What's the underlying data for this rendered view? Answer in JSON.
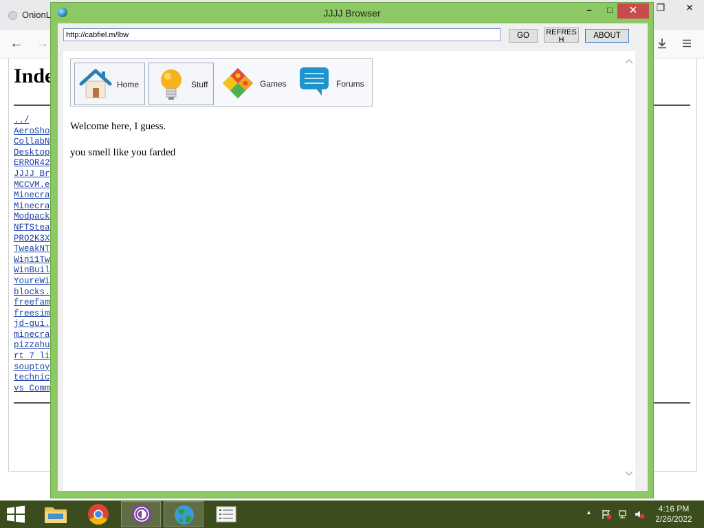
{
  "background_browser": {
    "tab_title": "OnionLi",
    "window_controls": [
      "❐",
      "✕"
    ],
    "page_heading": "Inde",
    "file_links": [
      "../",
      "AeroSho",
      "CollabN",
      "Desktop",
      "ERROR42",
      "JJJJ Br",
      "MCCVM.e",
      "Minecra",
      "Minecra",
      "Modpack",
      "NFTStea",
      "PRO2K3X",
      "TweakNT",
      "Win11Tw",
      "WinBuil",
      "YoureWi",
      "blocks.",
      "freefam",
      "freesim",
      "jd-gui.",
      "minecra",
      "pizzahu",
      "rt 7 li",
      "souptoy",
      "technic",
      "vs Comm"
    ]
  },
  "app": {
    "title": "JJJJ Browser",
    "url_value": "http://cabfiel.m/lbw",
    "go_label": "GO",
    "refresh_label": "REFRES H",
    "about_label": "ABOUT",
    "nav": [
      {
        "label": "Home",
        "icon": "home-icon"
      },
      {
        "label": "Stuff",
        "icon": "lightbulb-icon"
      },
      {
        "label": "Games",
        "icon": "puzzle-icon"
      },
      {
        "label": "Forums",
        "icon": "speech-bubble-icon"
      }
    ],
    "content": {
      "welcome": "Welcome here, I guess.",
      "line2": "you smell like you farded"
    }
  },
  "taskbar": {
    "items": [
      "file-explorer-icon",
      "chrome-icon",
      "tor-browser-icon",
      "jjjj-browser-icon",
      "task-list-icon"
    ],
    "clock_time": "4:16 PM",
    "clock_date": "2/26/2022"
  },
  "colors": {
    "window_frame": "#8cc863",
    "close_button": "#c94a4a",
    "taskbar": "#3b4d1c",
    "link": "#1a3fa8"
  }
}
